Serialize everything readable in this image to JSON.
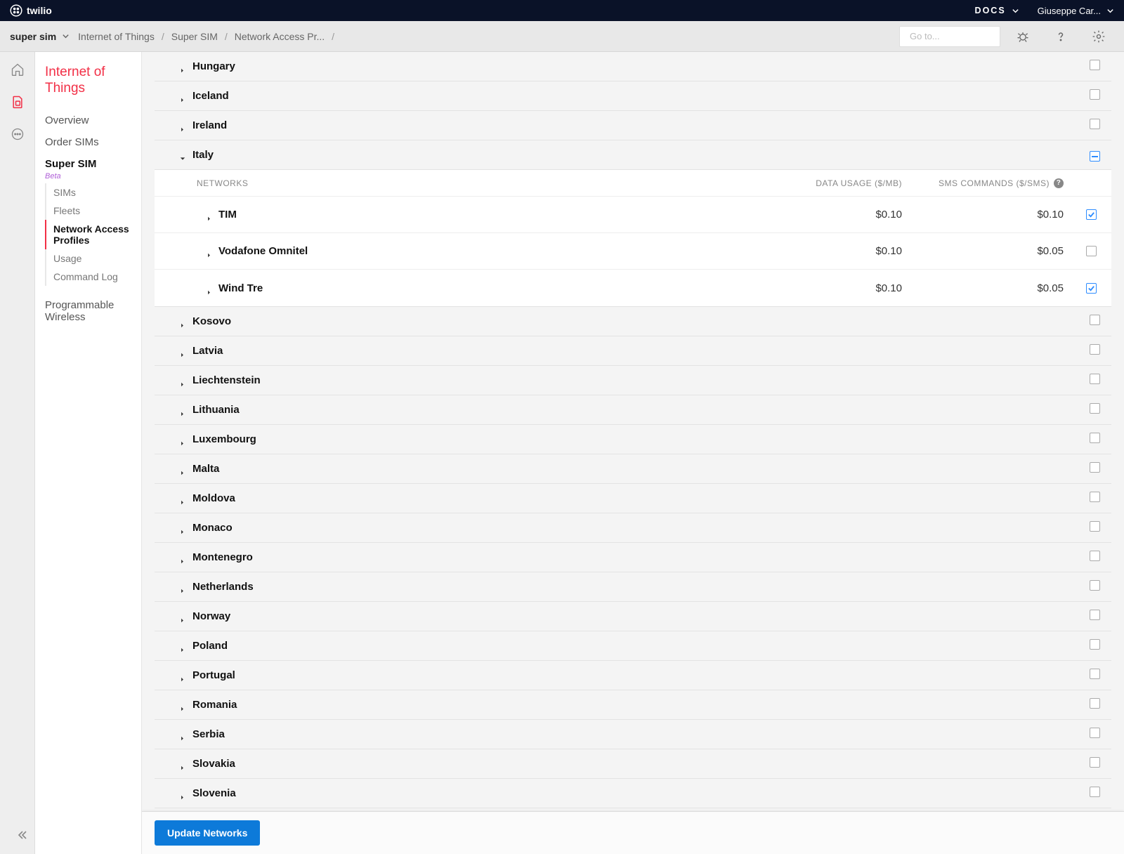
{
  "topbar": {
    "brand": "twilio",
    "docs": "DOCS",
    "user": "Giuseppe Car..."
  },
  "subbar": {
    "switcher": "super sim",
    "crumbs": [
      "Internet of Things",
      "Super SIM",
      "Network Access Pr..."
    ],
    "search_placeholder": "Go to..."
  },
  "sidebar": {
    "section": "Internet of Things",
    "items": {
      "overview": "Overview",
      "order": "Order SIMs",
      "supersim": "Super SIM",
      "beta": "Beta",
      "wireless": "Programmable Wireless"
    },
    "sub": {
      "sims": "SIMs",
      "fleets": "Fleets",
      "nap": "Network Access Profiles",
      "usage": "Usage",
      "cmd": "Command Log"
    }
  },
  "table": {
    "headers": {
      "networks": "NETWORKS",
      "data": "DATA USAGE ($/MB)",
      "sms": "SMS COMMANDS ($/SMS)"
    }
  },
  "countries": [
    {
      "name": "Hungary",
      "expanded": false,
      "state": "off"
    },
    {
      "name": "Iceland",
      "expanded": false,
      "state": "off"
    },
    {
      "name": "Ireland",
      "expanded": false,
      "state": "off"
    },
    {
      "name": "Italy",
      "expanded": true,
      "state": "partial",
      "networks": [
        {
          "name": "TIM",
          "data": "$0.10",
          "sms": "$0.10",
          "checked": true
        },
        {
          "name": "Vodafone Omnitel",
          "data": "$0.10",
          "sms": "$0.05",
          "checked": false
        },
        {
          "name": "Wind Tre",
          "data": "$0.10",
          "sms": "$0.05",
          "checked": true
        }
      ]
    },
    {
      "name": "Kosovo",
      "expanded": false,
      "state": "off"
    },
    {
      "name": "Latvia",
      "expanded": false,
      "state": "off"
    },
    {
      "name": "Liechtenstein",
      "expanded": false,
      "state": "off"
    },
    {
      "name": "Lithuania",
      "expanded": false,
      "state": "off"
    },
    {
      "name": "Luxembourg",
      "expanded": false,
      "state": "off"
    },
    {
      "name": "Malta",
      "expanded": false,
      "state": "off"
    },
    {
      "name": "Moldova",
      "expanded": false,
      "state": "off"
    },
    {
      "name": "Monaco",
      "expanded": false,
      "state": "off"
    },
    {
      "name": "Montenegro",
      "expanded": false,
      "state": "off"
    },
    {
      "name": "Netherlands",
      "expanded": false,
      "state": "off"
    },
    {
      "name": "Norway",
      "expanded": false,
      "state": "off"
    },
    {
      "name": "Poland",
      "expanded": false,
      "state": "off"
    },
    {
      "name": "Portugal",
      "expanded": false,
      "state": "off"
    },
    {
      "name": "Romania",
      "expanded": false,
      "state": "off"
    },
    {
      "name": "Serbia",
      "expanded": false,
      "state": "off"
    },
    {
      "name": "Slovakia",
      "expanded": false,
      "state": "off"
    },
    {
      "name": "Slovenia",
      "expanded": false,
      "state": "off"
    }
  ],
  "footer": {
    "update": "Update Networks"
  }
}
